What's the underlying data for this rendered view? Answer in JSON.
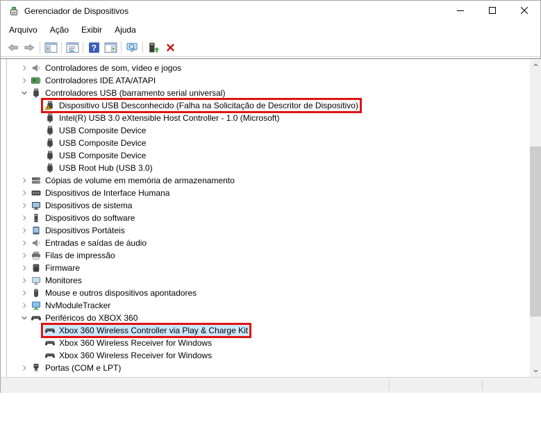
{
  "window": {
    "title": "Gerenciador de Dispositivos",
    "app_icon": "device-manager",
    "controls": [
      {
        "name": "minimize"
      },
      {
        "name": "maximize"
      },
      {
        "name": "close"
      }
    ]
  },
  "menu": {
    "items": [
      {
        "label": "Arquivo"
      },
      {
        "label": "Ação"
      },
      {
        "label": "Exibir"
      },
      {
        "label": "Ajuda"
      }
    ]
  },
  "toolbar": {
    "items": [
      {
        "name": "back"
      },
      {
        "name": "forward"
      },
      {
        "name": "separator"
      },
      {
        "name": "show-console-tree"
      },
      {
        "name": "separator"
      },
      {
        "name": "properties"
      },
      {
        "name": "separator"
      },
      {
        "name": "help"
      },
      {
        "name": "show-action-pane"
      },
      {
        "name": "separator"
      },
      {
        "name": "scan-hardware-changes"
      },
      {
        "name": "separator"
      },
      {
        "name": "update-driver"
      },
      {
        "name": "uninstall"
      }
    ]
  },
  "tree": {
    "items": [
      {
        "label": "Controladores de som, vídeo e jogos",
        "level": 0,
        "chevron": "collapsed",
        "icon": "speaker"
      },
      {
        "label": "Controladores IDE ATA/ATAPI",
        "level": 0,
        "chevron": "collapsed",
        "icon": "ide"
      },
      {
        "label": "Controladores USB (barramento serial universal)",
        "level": 0,
        "chevron": "expanded",
        "icon": "usb"
      },
      {
        "label": "Dispositivo USB Desconhecido (Falha na Solicitação de Descritor de Dispositivo)",
        "level": 1,
        "chevron": "none",
        "icon": "usb-warning",
        "red_box": true
      },
      {
        "label": "Intel(R) USB 3.0 eXtensible Host Controller - 1.0 (Microsoft)",
        "level": 1,
        "chevron": "none",
        "icon": "usb"
      },
      {
        "label": "USB Composite Device",
        "level": 1,
        "chevron": "none",
        "icon": "usb"
      },
      {
        "label": "USB Composite Device",
        "level": 1,
        "chevron": "none",
        "icon": "usb"
      },
      {
        "label": "USB Composite Device",
        "level": 1,
        "chevron": "none",
        "icon": "usb"
      },
      {
        "label": "USB Root Hub (USB 3.0)",
        "level": 1,
        "chevron": "none",
        "icon": "usb"
      },
      {
        "label": "Cópias de volume em memória de armazenamento",
        "level": 0,
        "chevron": "collapsed",
        "icon": "storage"
      },
      {
        "label": "Dispositivos de Interface Humana",
        "level": 0,
        "chevron": "collapsed",
        "icon": "hid"
      },
      {
        "label": "Dispositivos de sistema",
        "level": 0,
        "chevron": "collapsed",
        "icon": "system"
      },
      {
        "label": "Dispositivos do software",
        "level": 0,
        "chevron": "collapsed",
        "icon": "software"
      },
      {
        "label": "Dispositivos Portáteis",
        "level": 0,
        "chevron": "collapsed",
        "icon": "portable"
      },
      {
        "label": "Entradas e saídas de áudio",
        "level": 0,
        "chevron": "collapsed",
        "icon": "audio"
      },
      {
        "label": "Filas de impressão",
        "level": 0,
        "chevron": "collapsed",
        "icon": "printer"
      },
      {
        "label": "Firmware",
        "level": 0,
        "chevron": "collapsed",
        "icon": "firmware"
      },
      {
        "label": "Monitores",
        "level": 0,
        "chevron": "collapsed",
        "icon": "monitor"
      },
      {
        "label": "Mouse e outros dispositivos apontadores",
        "level": 0,
        "chevron": "collapsed",
        "icon": "mouse"
      },
      {
        "label": "NvModuleTracker",
        "level": 0,
        "chevron": "collapsed",
        "icon": "nv-module"
      },
      {
        "label": "Periféricos do XBOX 360",
        "level": 0,
        "chevron": "expanded",
        "icon": "xbox"
      },
      {
        "label": "Xbox 360 Wireless Controller via Play & Charge Kit",
        "level": 1,
        "chevron": "none",
        "icon": "xbox",
        "selected": true,
        "red_box": true
      },
      {
        "label": "Xbox 360 Wireless Receiver for Windows",
        "level": 1,
        "chevron": "none",
        "icon": "xbox"
      },
      {
        "label": "Xbox 360 Wireless Receiver for Windows",
        "level": 1,
        "chevron": "none",
        "icon": "xbox"
      },
      {
        "label": "Portas (COM e LPT)",
        "level": 0,
        "chevron": "collapsed",
        "icon": "ports"
      }
    ]
  },
  "colors": {
    "selection_bg": "#cce8ff",
    "annotation_red": "#e01212",
    "status_bar_bg": "#f0f0f0",
    "help_icon_blue": "#3b5fb8",
    "uninstall_red": "#c11818"
  }
}
